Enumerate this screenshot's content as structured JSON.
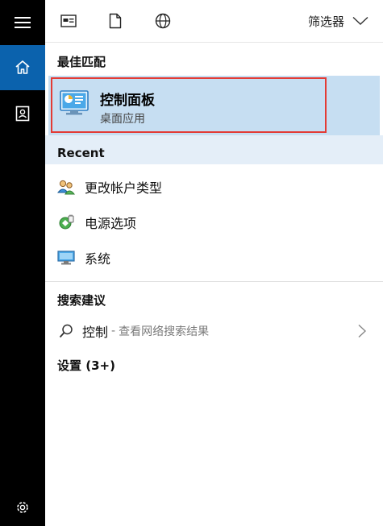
{
  "rail": {
    "items": [
      {
        "icon": "hamburger-menu-icon"
      },
      {
        "icon": "home-icon",
        "active": true
      },
      {
        "icon": "portrait-icon"
      },
      {
        "icon": "gear-icon"
      }
    ]
  },
  "toolbar": {
    "icons": [
      "apps-icon",
      "documents-icon",
      "web-icon"
    ],
    "filter_label": "筛选器"
  },
  "best_match": {
    "section_title": "最佳匹配",
    "title": "控制面板",
    "subtitle": "桌面应用"
  },
  "recent": {
    "section_title": "Recent",
    "items": [
      {
        "label": "更改帐户类型",
        "icon": "user-accounts-icon"
      },
      {
        "label": "电源选项",
        "icon": "power-options-icon"
      },
      {
        "label": "系统",
        "icon": "system-monitor-icon"
      }
    ]
  },
  "suggestions": {
    "section_title": "搜索建议",
    "query": "控制",
    "separator": "-",
    "hint": "查看网络搜索结果"
  },
  "settings": {
    "section_title": "设置 (3+)"
  },
  "colors": {
    "rail_bg": "#000000",
    "rail_active": "#0b62ad",
    "best_match_bg": "#c6def2",
    "recent_bg": "#e4eef8",
    "highlight_outline": "#e33b35"
  }
}
